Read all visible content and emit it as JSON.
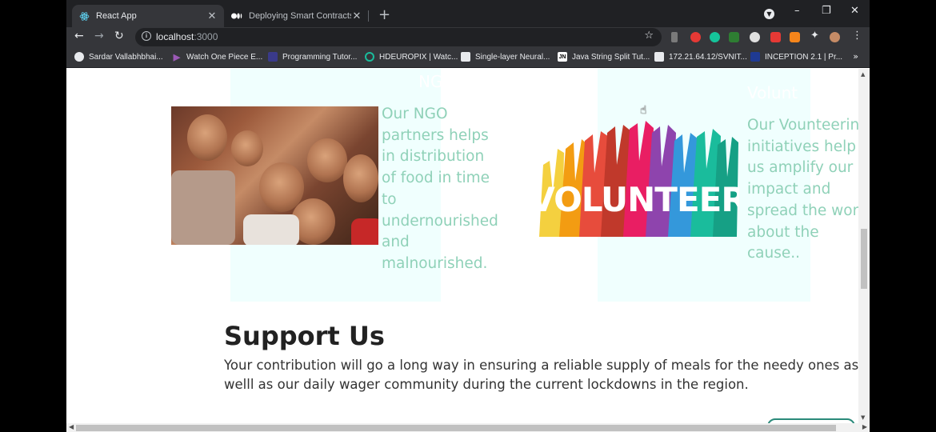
{
  "browser": {
    "tabs": [
      {
        "title": "React App",
        "icon": "react-icon"
      },
      {
        "title": "Deploying Smart Contracts with",
        "icon": "medium-icon"
      }
    ],
    "new_tab_label": "+",
    "address": {
      "host": "localhost",
      "port": ":3000"
    },
    "window_controls": {
      "minimize": "–",
      "restore": "❐",
      "close": "✕"
    },
    "bookmarks": [
      {
        "label": "Sardar Vallabhbhai...",
        "icon": "globe-icon",
        "color": "#e8eaed"
      },
      {
        "label": "Watch One Piece E...",
        "icon": "play-icon",
        "color": "#9b59b6"
      },
      {
        "label": "Programming Tutor...",
        "icon": "site-icon",
        "color": "#3a3a8a"
      },
      {
        "label": "HDEUROPIX | Watc...",
        "icon": "circle-icon",
        "color": "#1abc9c"
      },
      {
        "label": "Single-layer Neural...",
        "icon": "doc-icon",
        "color": "#e8eaed"
      },
      {
        "label": "Java String Split Tut...",
        "icon": "jn-icon",
        "color": "#ffffff"
      },
      {
        "label": "172.21.64.12/SVNIT...",
        "icon": "page-icon",
        "color": "#e8eaed"
      },
      {
        "label": "INCEPTION 2.1 | Pr...",
        "icon": "site-icon",
        "color": "#1f3a93"
      }
    ],
    "bookmarks_more": "»"
  },
  "page": {
    "cards": [
      {
        "title": "NG",
        "text": [
          "Our NGO",
          "partners helps",
          "in distribution",
          "of food in time",
          "to",
          "undernourished",
          "and",
          "malnourished."
        ]
      },
      {
        "title": "Volunt",
        "image_text": "VOLUNTEER",
        "text": [
          "Our Vounteering",
          "initiatives help",
          "us amplify our",
          "impact and",
          "spread the word",
          "about the",
          "cause.."
        ]
      }
    ],
    "support": {
      "title": "Support Us",
      "description": "Your contribution will go a long way in ensuring a reliable supply of meals for the needy ones as welll as our daily wager community during the current lockdowns in the region."
    }
  },
  "colors": {
    "card_bg": "#f0fffe",
    "card_text": "#8fd1b8",
    "chrome_dark": "#202124",
    "chrome_toolbar": "#35363a"
  }
}
